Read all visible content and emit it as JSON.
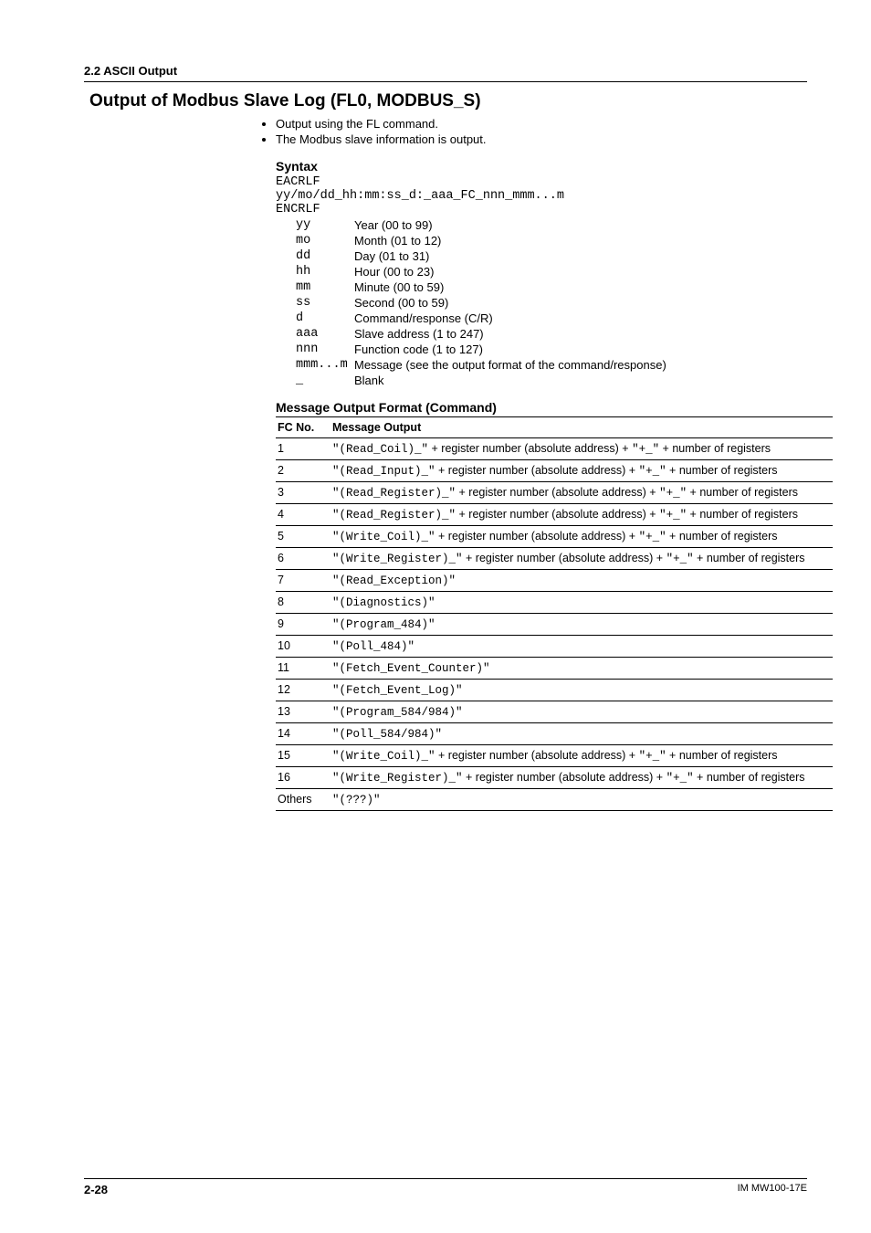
{
  "crumb": "2.2  ASCII Output",
  "title": "Output of Modbus Slave Log (FL0, MODBUS_S)",
  "bullets": [
    "Output using the FL command.",
    "The Modbus slave information is output."
  ],
  "syntax": {
    "heading": "Syntax",
    "line1": "EACRLF",
    "line2": "yy/mo/dd_hh:mm:ss_d:_aaa_FC_nnn_mmm...m",
    "line3": "ENCRLF",
    "defs": [
      {
        "k": "yy",
        "v": "Year (00 to 99)"
      },
      {
        "k": "mo",
        "v": "Month (01 to 12)"
      },
      {
        "k": "dd",
        "v": "Day (01 to 31)"
      },
      {
        "k": "hh",
        "v": "Hour (00 to 23)"
      },
      {
        "k": "mm",
        "v": "Minute (00 to 59)"
      },
      {
        "k": "ss",
        "v": "Second (00 to 59)"
      },
      {
        "k": "d",
        "v": "Command/response (C/R)"
      },
      {
        "k": "aaa",
        "v": "Slave address (1 to 247)"
      },
      {
        "k": "nnn",
        "v": "Function code (1 to 127)"
      },
      {
        "k": "mmm...m",
        "v": "Message (see the output format of the command/response)"
      },
      {
        "k": "_",
        "v": "Blank"
      }
    ]
  },
  "msg_heading": "Message Output Format (Command)",
  "msg_table": {
    "head": [
      "FC No.",
      "Message Output"
    ],
    "rows": [
      {
        "fc": "1",
        "mono": "\"(Read_Coil)_\"",
        "rest": " + register number (absolute address) +  ",
        "mono2": "\"+_\"",
        "rest2": " + number of registers"
      },
      {
        "fc": "2",
        "mono": "\"(Read_Input)_\"",
        "rest": " + register number (absolute address) + ",
        "mono2": "\"+_\"",
        "rest2": " + number of registers"
      },
      {
        "fc": "3",
        "mono": "\"(Read_Register)_\"",
        "rest": " + register number (absolute address) + ",
        "mono2": "\"+_\"",
        "rest2": " + number of registers"
      },
      {
        "fc": "4",
        "mono": "\"(Read_Register)_\"",
        "rest": " + register number (absolute address) + ",
        "mono2": "\"+_\"",
        "rest2": " + number of registers"
      },
      {
        "fc": "5",
        "mono": "\"(Write_Coil)_\"",
        "rest": " + register number (absolute address) + ",
        "mono2": "\"+_\"",
        "rest2": " + number of registers"
      },
      {
        "fc": "6",
        "mono": "\"(Write_Register)_\"",
        "rest": " + register number (absolute address) + ",
        "mono2": "\"+_\"",
        "rest2": " + number of registers"
      },
      {
        "fc": "7",
        "mono": "\"(Read_Exception)\"",
        "rest": "",
        "mono2": "",
        "rest2": ""
      },
      {
        "fc": "8",
        "mono": "\"(Diagnostics)\"",
        "rest": "",
        "mono2": "",
        "rest2": ""
      },
      {
        "fc": "9",
        "mono": "\"(Program_484)\"",
        "rest": "",
        "mono2": "",
        "rest2": ""
      },
      {
        "fc": "10",
        "mono": "\"(Poll_484)\"",
        "rest": "",
        "mono2": "",
        "rest2": ""
      },
      {
        "fc": "11",
        "mono": "\"(Fetch_Event_Counter)\"",
        "rest": "",
        "mono2": "",
        "rest2": ""
      },
      {
        "fc": "12",
        "mono": "\"(Fetch_Event_Log)\"",
        "rest": "",
        "mono2": "",
        "rest2": ""
      },
      {
        "fc": "13",
        "mono": "\"(Program_584/984)\"",
        "rest": "",
        "mono2": "",
        "rest2": ""
      },
      {
        "fc": "14",
        "mono": "\"(Poll_584/984)\"",
        "rest": "",
        "mono2": "",
        "rest2": ""
      },
      {
        "fc": "15",
        "mono": "\"(Write_Coil)_\"",
        "rest": " + register number (absolute address) + ",
        "mono2": "\"+_\"",
        "rest2": "  + number of registers"
      },
      {
        "fc": "16",
        "mono": "\"(Write_Register)_\"",
        "rest": " + register number (absolute address) +  ",
        "mono2": "\"+_\"",
        "rest2": " + number of registers"
      },
      {
        "fc": "Others",
        "mono": "\"(???)\"",
        "rest": "",
        "mono2": "",
        "rest2": ""
      }
    ]
  },
  "footer": {
    "page": "2-28",
    "doc": "IM MW100-17E"
  }
}
